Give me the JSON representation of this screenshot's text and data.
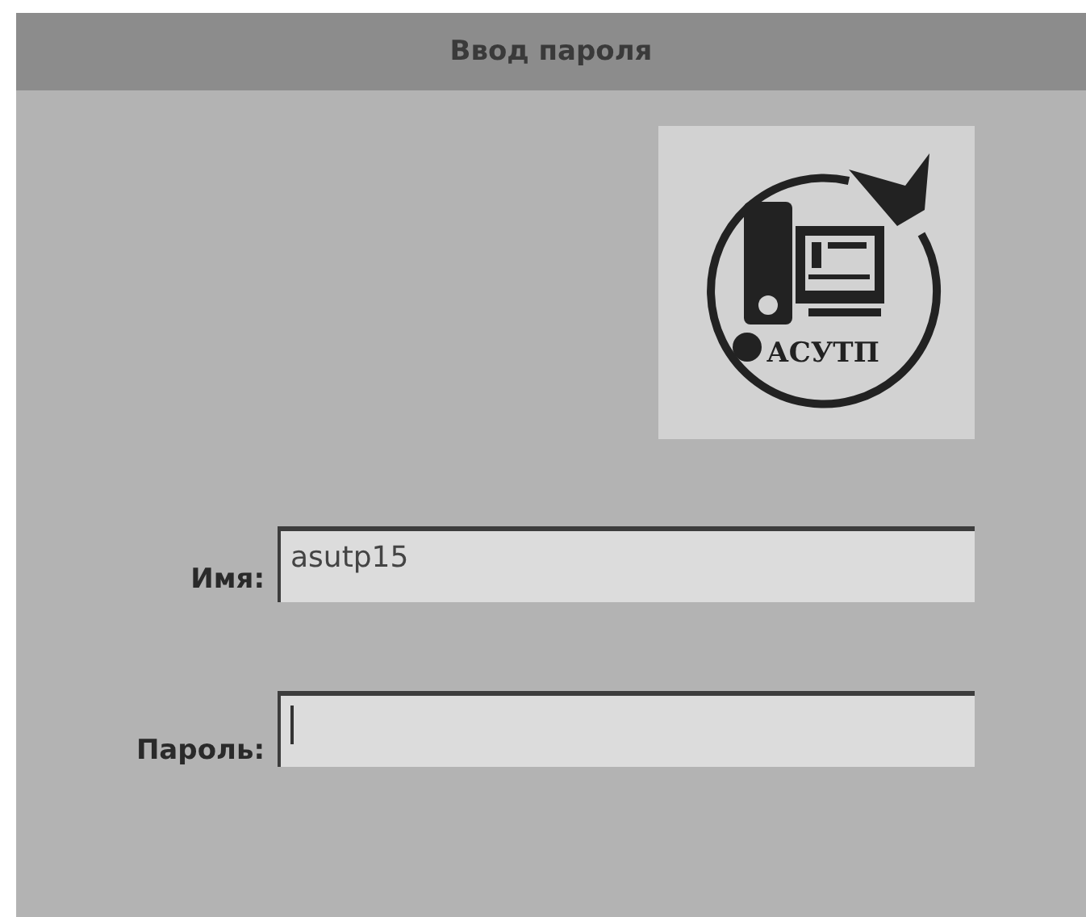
{
  "window": {
    "title": "Ввод пароля"
  },
  "logo": {
    "text": "АСУТП"
  },
  "fields": [
    {
      "label": "Имя:",
      "value": "asutp15",
      "focused": false
    },
    {
      "label": "Пароль:",
      "focused": true
    }
  ]
}
